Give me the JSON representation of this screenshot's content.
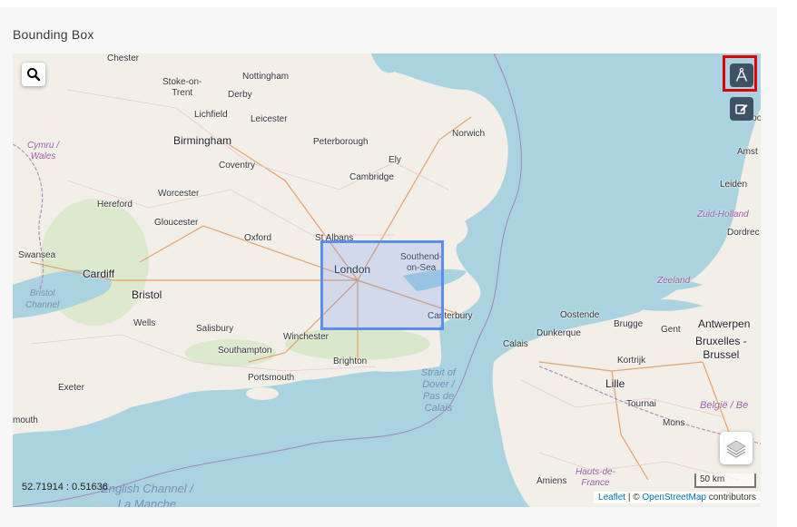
{
  "panel": {
    "title": "Bounding Box"
  },
  "map": {
    "coords_readout": "52.71914 : 0.51636",
    "scale_label": "50 km",
    "attribution": {
      "leaflet": "Leaflet",
      "separator": " | © ",
      "osm": "OpenStreetMap",
      "suffix": " contributors"
    },
    "labels": {
      "chester": "Chester",
      "stoke": "Stoke-on-\nTrent",
      "nottingham": "Nottingham",
      "derby": "Derby",
      "lichfield": "Lichfield",
      "leicester": "Leicester",
      "birmingham": "Birmingham",
      "coventry": "Coventry",
      "peterborough": "Peterborough",
      "norwich": "Norwich",
      "ely": "Ely",
      "cambridge": "Cambridge",
      "worcester": "Worcester",
      "hereford": "Hereford",
      "gloucester": "Gloucester",
      "oxford": "Oxford",
      "stalbans": "St Albans",
      "london": "London",
      "southend": "Southend-\non-Sea",
      "swansea": "Swansea",
      "cardiff": "Cardiff",
      "bristol": "Bristol",
      "wells": "Wells",
      "salisbury": "Salisbury",
      "winchester": "Winchester",
      "southampton": "Southampton",
      "portsmouth": "Portsmouth",
      "brighton": "Brighton",
      "canterbury": "Canterbury",
      "calais": "Calais",
      "dunkerque": "Dunkerque",
      "oostende": "Oostende",
      "brugge": "Brugge",
      "gent": "Gent",
      "antwerpen": "Antwerpen",
      "bruxelles": "Bruxelles -\nBrussel",
      "kortrijk": "Kortrijk",
      "lille": "Lille",
      "tournai": "Tournai",
      "mons": "Mons",
      "belgie": "België / Be",
      "amiens": "Amiens",
      "hauts": "Hauts-de-\nFrance",
      "exeter": "Exeter",
      "plymouth": "mouth",
      "amst": "Amst",
      "leiden": "Leiden",
      "dordrec": "Dordrec",
      "noord": "Noo",
      "zuidholland": "Zuid-Holland",
      "zeeland": "Zeeland",
      "cymru": "Cymru /\nWales",
      "bristol_channel": "Bristol\nChannel",
      "strait": "Strait of\nDover /\nPas de\nCalais",
      "english_channel": "English Channel /\nLa Manche"
    }
  },
  "controls": {
    "search_icon": "magnifier-icon",
    "measure_icon": "compass-icon",
    "edit_icon": "edit-icon",
    "layers_icon": "layers-icon"
  },
  "colors": {
    "highlight": "#e0000a",
    "bbox": "#5b8def",
    "control_dark": "#3e5266"
  }
}
